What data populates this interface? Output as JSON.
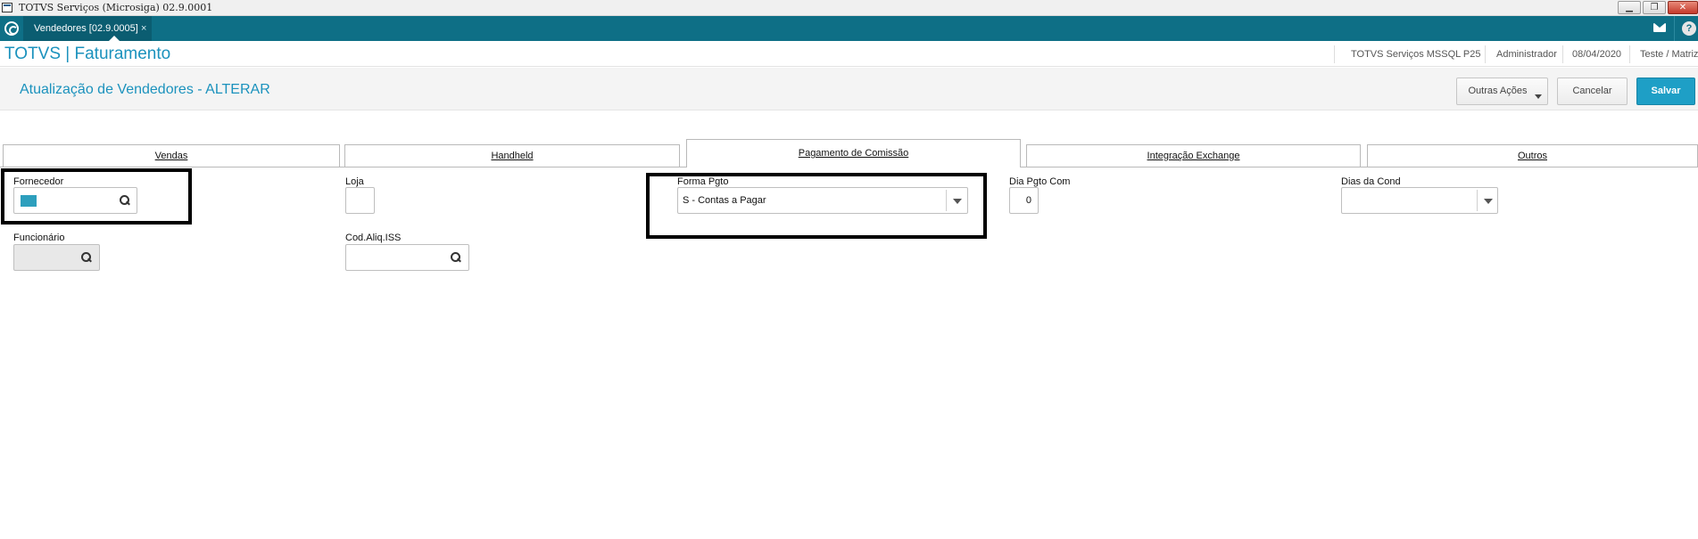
{
  "window": {
    "title": "TOTVS Serviços (Microsiga) 02.9.0001",
    "buttons": {
      "minimize": "▁",
      "restore": "❐",
      "close": "✕"
    }
  },
  "tabbar": {
    "program_tab": "Vendedores [02.9.0005]",
    "close_glyph": "×",
    "help_glyph": "?"
  },
  "header": {
    "module_title": "TOTVS | Faturamento",
    "environment": "TOTVS Serviços MSSQL P25",
    "user": "Administrador",
    "date": "08/04/2020",
    "company": "Teste / Matriz"
  },
  "page": {
    "title": "Atualização de Vendedores - ALTERAR",
    "actions": {
      "other": "Outras Ações",
      "cancel": "Cancelar",
      "save": "Salvar"
    }
  },
  "tabs": [
    {
      "label": "Vendas",
      "active": false
    },
    {
      "label": "Handheld",
      "active": false
    },
    {
      "label": "Pagamento de Comissão",
      "active": true
    },
    {
      "label": "Integração Exchange",
      "active": false
    },
    {
      "label": "Outros",
      "active": false
    }
  ],
  "form": {
    "fornecedor": {
      "label": "Fornecedor",
      "value": ""
    },
    "loja": {
      "label": "Loja",
      "value": ""
    },
    "forma_pgto": {
      "label": "Forma Pgto",
      "value": "S - Contas a Pagar"
    },
    "dia_pgto_com": {
      "label": "Dia Pgto Com",
      "value": "0"
    },
    "dias_da_cond": {
      "label": "Dias da Cond",
      "value": ""
    },
    "funcionario": {
      "label": "Funcionário",
      "value": ""
    },
    "cod_aliq_iss": {
      "label": "Cod.Aliq.ISS",
      "value": ""
    }
  },
  "colors": {
    "tabbar_bg": "#0e6f86",
    "accent": "#1b92bd",
    "save_button": "#1e9fc6",
    "highlight_border": "#000000"
  },
  "icons": [
    "home-icon",
    "mail-icon",
    "help-icon",
    "search-icon",
    "chevron-down-icon"
  ]
}
